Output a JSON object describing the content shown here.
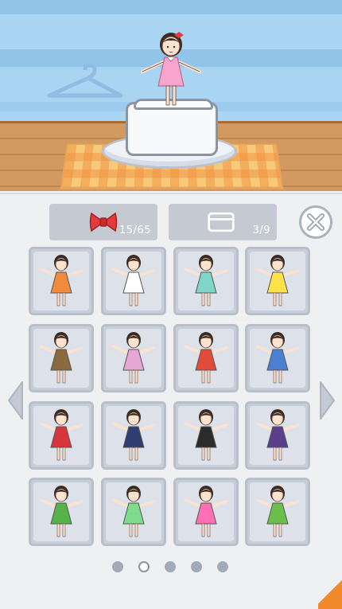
{
  "scene": {
    "character": "girl-in-pink-dress",
    "pedestal": "tofu-on-plate",
    "colors": {
      "sky": "#a9d4f2",
      "dress": "#f7a4cf",
      "bow": "#e23b3b"
    }
  },
  "counters": {
    "bows": {
      "icon": "ribbon-bow-icon",
      "text": "15/65",
      "color": "#e23b3b"
    },
    "boxes": {
      "icon": "box-icon",
      "text": "3/9"
    }
  },
  "outfits": [
    {
      "name": "orange-dress",
      "color": "#f28a3c"
    },
    {
      "name": "white-ghost",
      "color": "#ffffff"
    },
    {
      "name": "teal-dress",
      "color": "#7fd6c8"
    },
    {
      "name": "cheerleader",
      "color": "#ffe14a"
    },
    {
      "name": "tribal-spear",
      "color": "#8a6a3c"
    },
    {
      "name": "pink-bunny",
      "color": "#e8a7d6"
    },
    {
      "name": "basketball",
      "color": "#e14c3a"
    },
    {
      "name": "tennis",
      "color": "#4a7fd1"
    },
    {
      "name": "shrine-maiden",
      "color": "#d8343c"
    },
    {
      "name": "police",
      "color": "#2e3d72"
    },
    {
      "name": "business-suit",
      "color": "#2b2b2b"
    },
    {
      "name": "jiangshi",
      "color": "#5b3f8a"
    },
    {
      "name": "hula",
      "color": "#58b24a"
    },
    {
      "name": "fairy",
      "color": "#7fdc8c"
    },
    {
      "name": "idol-singer",
      "color": "#ff6fb4"
    },
    {
      "name": "heian-kimono",
      "color": "#6bbf4a"
    }
  ],
  "pagination": {
    "count": 5,
    "active": 1
  }
}
